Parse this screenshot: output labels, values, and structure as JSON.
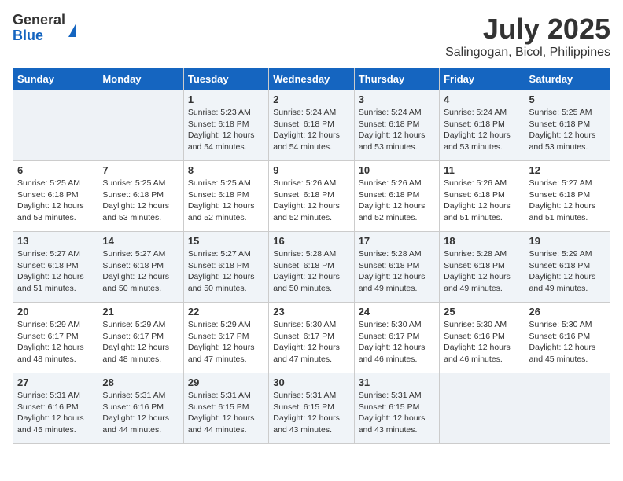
{
  "logo": {
    "general": "General",
    "blue": "Blue"
  },
  "title": "July 2025",
  "location": "Salingogan, Bicol, Philippines",
  "days_of_week": [
    "Sunday",
    "Monday",
    "Tuesday",
    "Wednesday",
    "Thursday",
    "Friday",
    "Saturday"
  ],
  "weeks": [
    [
      {
        "day": "",
        "info": ""
      },
      {
        "day": "",
        "info": ""
      },
      {
        "day": "1",
        "info": "Sunrise: 5:23 AM\nSunset: 6:18 PM\nDaylight: 12 hours and 54 minutes."
      },
      {
        "day": "2",
        "info": "Sunrise: 5:24 AM\nSunset: 6:18 PM\nDaylight: 12 hours and 54 minutes."
      },
      {
        "day": "3",
        "info": "Sunrise: 5:24 AM\nSunset: 6:18 PM\nDaylight: 12 hours and 53 minutes."
      },
      {
        "day": "4",
        "info": "Sunrise: 5:24 AM\nSunset: 6:18 PM\nDaylight: 12 hours and 53 minutes."
      },
      {
        "day": "5",
        "info": "Sunrise: 5:25 AM\nSunset: 6:18 PM\nDaylight: 12 hours and 53 minutes."
      }
    ],
    [
      {
        "day": "6",
        "info": "Sunrise: 5:25 AM\nSunset: 6:18 PM\nDaylight: 12 hours and 53 minutes."
      },
      {
        "day": "7",
        "info": "Sunrise: 5:25 AM\nSunset: 6:18 PM\nDaylight: 12 hours and 53 minutes."
      },
      {
        "day": "8",
        "info": "Sunrise: 5:25 AM\nSunset: 6:18 PM\nDaylight: 12 hours and 52 minutes."
      },
      {
        "day": "9",
        "info": "Sunrise: 5:26 AM\nSunset: 6:18 PM\nDaylight: 12 hours and 52 minutes."
      },
      {
        "day": "10",
        "info": "Sunrise: 5:26 AM\nSunset: 6:18 PM\nDaylight: 12 hours and 52 minutes."
      },
      {
        "day": "11",
        "info": "Sunrise: 5:26 AM\nSunset: 6:18 PM\nDaylight: 12 hours and 51 minutes."
      },
      {
        "day": "12",
        "info": "Sunrise: 5:27 AM\nSunset: 6:18 PM\nDaylight: 12 hours and 51 minutes."
      }
    ],
    [
      {
        "day": "13",
        "info": "Sunrise: 5:27 AM\nSunset: 6:18 PM\nDaylight: 12 hours and 51 minutes."
      },
      {
        "day": "14",
        "info": "Sunrise: 5:27 AM\nSunset: 6:18 PM\nDaylight: 12 hours and 50 minutes."
      },
      {
        "day": "15",
        "info": "Sunrise: 5:27 AM\nSunset: 6:18 PM\nDaylight: 12 hours and 50 minutes."
      },
      {
        "day": "16",
        "info": "Sunrise: 5:28 AM\nSunset: 6:18 PM\nDaylight: 12 hours and 50 minutes."
      },
      {
        "day": "17",
        "info": "Sunrise: 5:28 AM\nSunset: 6:18 PM\nDaylight: 12 hours and 49 minutes."
      },
      {
        "day": "18",
        "info": "Sunrise: 5:28 AM\nSunset: 6:18 PM\nDaylight: 12 hours and 49 minutes."
      },
      {
        "day": "19",
        "info": "Sunrise: 5:29 AM\nSunset: 6:18 PM\nDaylight: 12 hours and 49 minutes."
      }
    ],
    [
      {
        "day": "20",
        "info": "Sunrise: 5:29 AM\nSunset: 6:17 PM\nDaylight: 12 hours and 48 minutes."
      },
      {
        "day": "21",
        "info": "Sunrise: 5:29 AM\nSunset: 6:17 PM\nDaylight: 12 hours and 48 minutes."
      },
      {
        "day": "22",
        "info": "Sunrise: 5:29 AM\nSunset: 6:17 PM\nDaylight: 12 hours and 47 minutes."
      },
      {
        "day": "23",
        "info": "Sunrise: 5:30 AM\nSunset: 6:17 PM\nDaylight: 12 hours and 47 minutes."
      },
      {
        "day": "24",
        "info": "Sunrise: 5:30 AM\nSunset: 6:17 PM\nDaylight: 12 hours and 46 minutes."
      },
      {
        "day": "25",
        "info": "Sunrise: 5:30 AM\nSunset: 6:16 PM\nDaylight: 12 hours and 46 minutes."
      },
      {
        "day": "26",
        "info": "Sunrise: 5:30 AM\nSunset: 6:16 PM\nDaylight: 12 hours and 45 minutes."
      }
    ],
    [
      {
        "day": "27",
        "info": "Sunrise: 5:31 AM\nSunset: 6:16 PM\nDaylight: 12 hours and 45 minutes."
      },
      {
        "day": "28",
        "info": "Sunrise: 5:31 AM\nSunset: 6:16 PM\nDaylight: 12 hours and 44 minutes."
      },
      {
        "day": "29",
        "info": "Sunrise: 5:31 AM\nSunset: 6:15 PM\nDaylight: 12 hours and 44 minutes."
      },
      {
        "day": "30",
        "info": "Sunrise: 5:31 AM\nSunset: 6:15 PM\nDaylight: 12 hours and 43 minutes."
      },
      {
        "day": "31",
        "info": "Sunrise: 5:31 AM\nSunset: 6:15 PM\nDaylight: 12 hours and 43 minutes."
      },
      {
        "day": "",
        "info": ""
      },
      {
        "day": "",
        "info": ""
      }
    ]
  ]
}
